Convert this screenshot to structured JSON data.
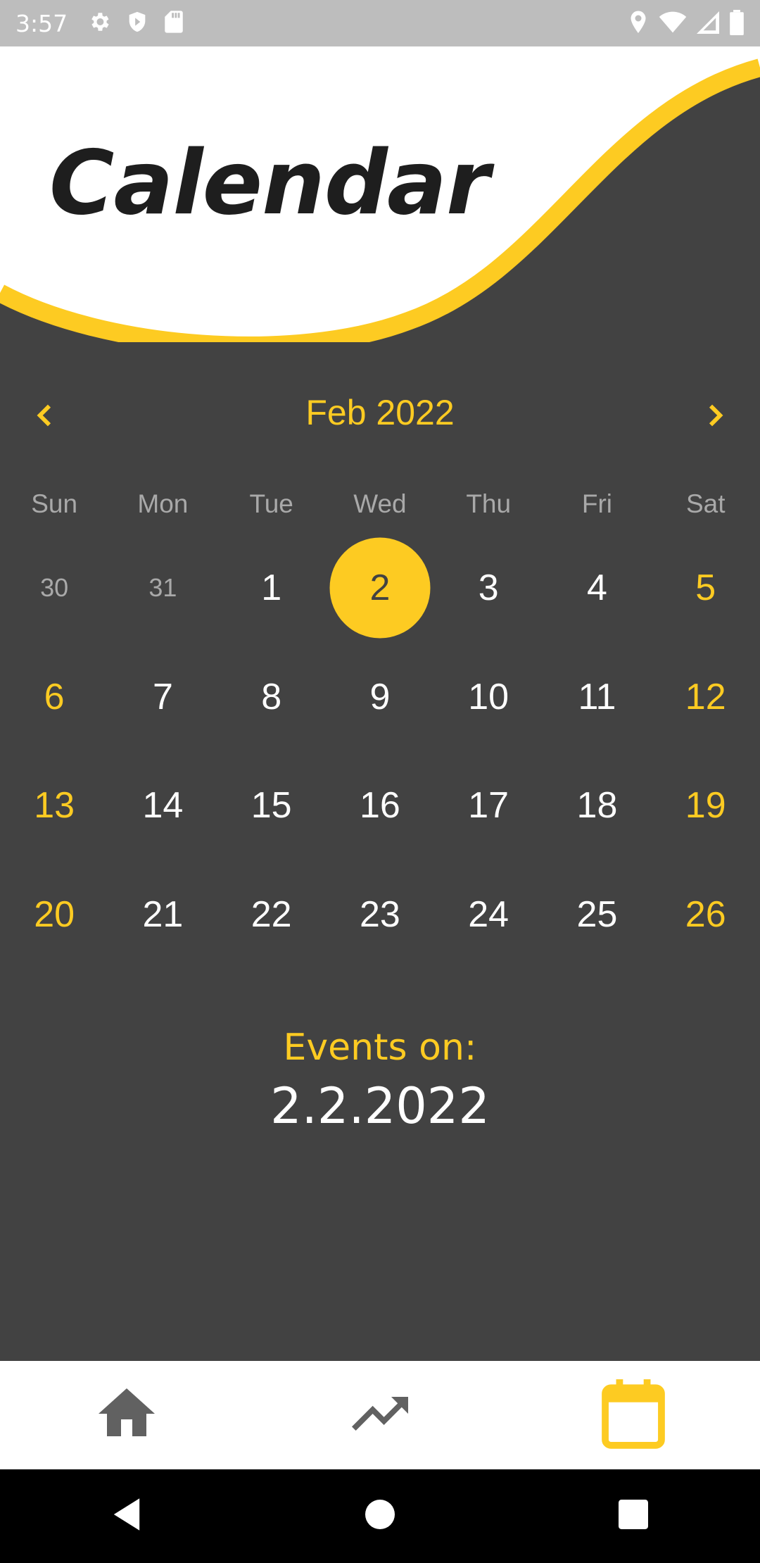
{
  "status_bar": {
    "time": "3:57",
    "left_icons": [
      "settings-icon",
      "shield-icon",
      "sd-card-icon"
    ],
    "right_icons": [
      "location-icon",
      "wifi-icon",
      "cell-signal-icon",
      "battery-icon"
    ]
  },
  "header": {
    "title": "Calendar"
  },
  "calendar": {
    "month_label": "Feb 2022",
    "prev_icon": "chevron-left-icon",
    "next_icon": "chevron-right-icon",
    "weekdays": [
      "Sun",
      "Mon",
      "Tue",
      "Wed",
      "Thu",
      "Fri",
      "Sat"
    ],
    "days": [
      {
        "label": "30",
        "outside": true,
        "weekend": false
      },
      {
        "label": "31",
        "outside": true,
        "weekend": false
      },
      {
        "label": "1",
        "outside": false,
        "weekend": false
      },
      {
        "label": "2",
        "outside": false,
        "weekend": false,
        "selected": true
      },
      {
        "label": "3",
        "outside": false,
        "weekend": false
      },
      {
        "label": "4",
        "outside": false,
        "weekend": false
      },
      {
        "label": "5",
        "outside": false,
        "weekend": true
      },
      {
        "label": "6",
        "outside": false,
        "weekend": true
      },
      {
        "label": "7",
        "outside": false,
        "weekend": false
      },
      {
        "label": "8",
        "outside": false,
        "weekend": false
      },
      {
        "label": "9",
        "outside": false,
        "weekend": false
      },
      {
        "label": "10",
        "outside": false,
        "weekend": false
      },
      {
        "label": "11",
        "outside": false,
        "weekend": false
      },
      {
        "label": "12",
        "outside": false,
        "weekend": true
      },
      {
        "label": "13",
        "outside": false,
        "weekend": true
      },
      {
        "label": "14",
        "outside": false,
        "weekend": false
      },
      {
        "label": "15",
        "outside": false,
        "weekend": false
      },
      {
        "label": "16",
        "outside": false,
        "weekend": false
      },
      {
        "label": "17",
        "outside": false,
        "weekend": false
      },
      {
        "label": "18",
        "outside": false,
        "weekend": false
      },
      {
        "label": "19",
        "outside": false,
        "weekend": true
      },
      {
        "label": "20",
        "outside": false,
        "weekend": true
      },
      {
        "label": "21",
        "outside": false,
        "weekend": false
      },
      {
        "label": "22",
        "outside": false,
        "weekend": false
      },
      {
        "label": "23",
        "outside": false,
        "weekend": false
      },
      {
        "label": "24",
        "outside": false,
        "weekend": false
      },
      {
        "label": "25",
        "outside": false,
        "weekend": false
      },
      {
        "label": "26",
        "outside": false,
        "weekend": true
      }
    ]
  },
  "events": {
    "label": "Events on:",
    "date": "2.2.2022"
  },
  "bottom_nav": {
    "items": [
      {
        "icon": "home-icon",
        "active": false
      },
      {
        "icon": "trending-up-icon",
        "active": false
      },
      {
        "icon": "calendar-icon",
        "active": true
      }
    ]
  },
  "system_nav": {
    "items": [
      "back-icon",
      "home-circle-icon",
      "recents-icon"
    ]
  },
  "colors": {
    "accent": "#fdcb22",
    "background": "#424242",
    "header_bg": "#ffffff",
    "title_text": "#1e1e1e",
    "muted_text": "#a9a9a9",
    "inactive_icon": "#616161"
  }
}
